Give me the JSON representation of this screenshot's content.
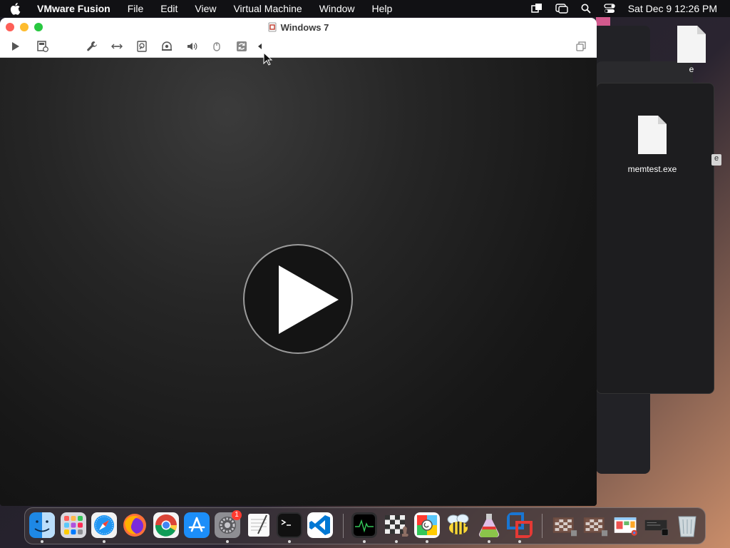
{
  "menubar": {
    "app_name": "VMware Fusion",
    "items": [
      "File",
      "Edit",
      "View",
      "Virtual Machine",
      "Window",
      "Help"
    ],
    "clock": "Sat Dec 9  12:26 PM"
  },
  "window": {
    "title": "Windows 7",
    "toolbar_icons": [
      "play-icon",
      "snapshot-icon",
      "settings-wrench-icon",
      "network-icon",
      "hard-disk-icon",
      "camera-icon",
      "sound-icon",
      "usb-icon",
      "refresh-icon",
      "collapse-arrow-icon",
      "unity-icon"
    ]
  },
  "desktop": {
    "files": [
      {
        "name": "e"
      },
      {
        "name": "memtest.exe"
      }
    ],
    "sidebar_tab": "e"
  },
  "dock": {
    "apps": [
      "Finder",
      "Launchpad",
      "Safari",
      "Firefox",
      "Chrome",
      "App Store",
      "System Settings",
      "TextEdit",
      "Terminal",
      "Visual Studio Code",
      "Activity Monitor",
      "Chess",
      "ColorSync",
      "Cyberduck",
      "Potion",
      "VMware Fusion"
    ],
    "settings_badge": "1"
  },
  "colors": {
    "menubar_bg": "#111114",
    "titlebar_bg": "#ffffff",
    "close": "#fe5f57",
    "minimize": "#febc2e",
    "maximize": "#28c840"
  }
}
